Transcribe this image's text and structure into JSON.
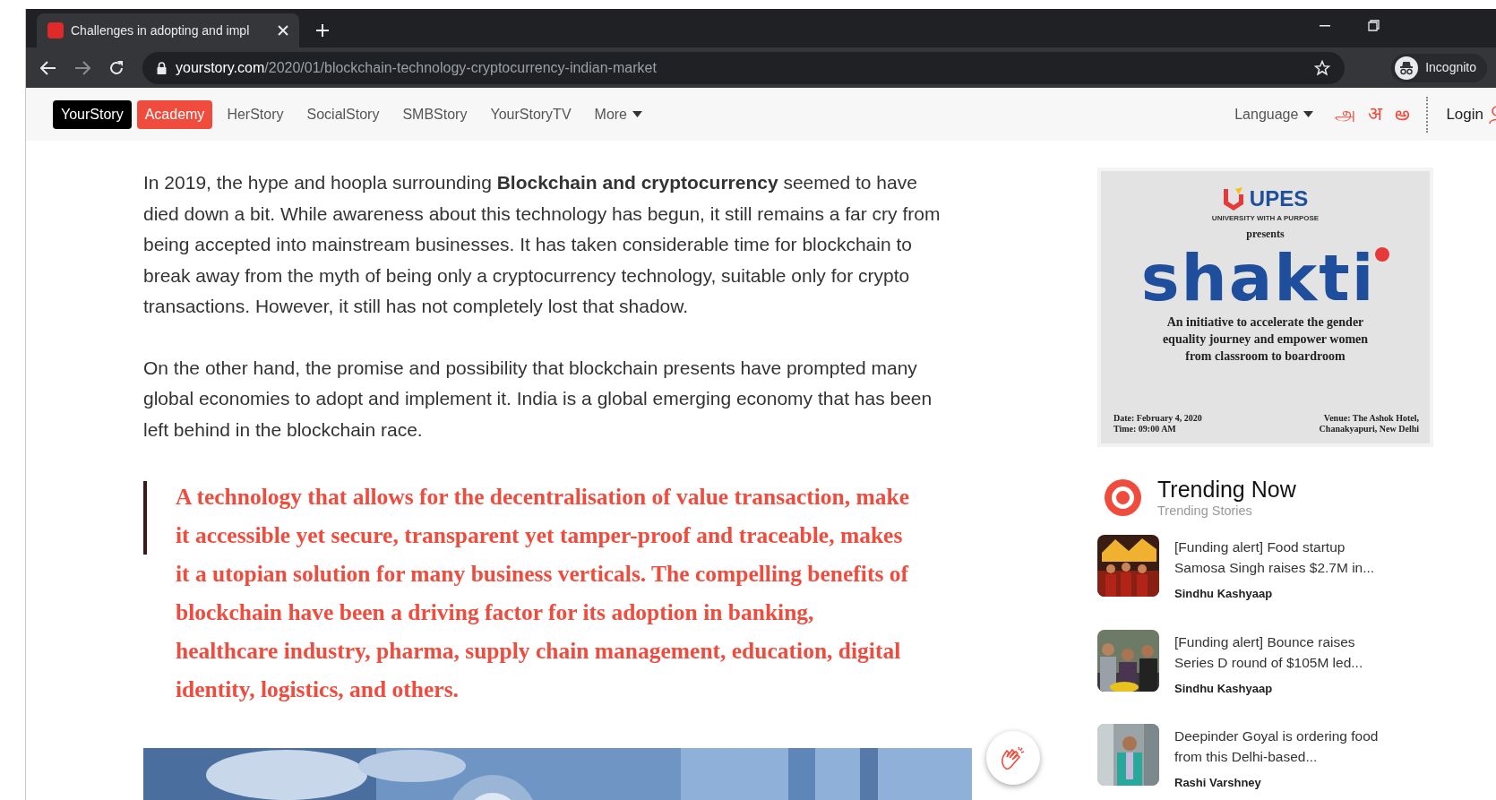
{
  "browser": {
    "tab_title": "Challenges in adopting and impl",
    "url_host": "yourstory.com",
    "url_path": "/2020/01/blockchain-technology-cryptocurrency-indian-market",
    "profile": "Incognito"
  },
  "nav": {
    "items": [
      {
        "label": "YourStory",
        "kind": "brand"
      },
      {
        "label": "Academy",
        "kind": "highlight"
      },
      {
        "label": "HerStory",
        "kind": "link"
      },
      {
        "label": "SocialStory",
        "kind": "link"
      },
      {
        "label": "SMBStory",
        "kind": "link"
      },
      {
        "label": "YourStoryTV",
        "kind": "link"
      },
      {
        "label": "More",
        "kind": "dropdown"
      }
    ],
    "language": "Language",
    "scripts": [
      "அ",
      "अ",
      "అ"
    ],
    "login": "Login"
  },
  "article": {
    "paragraphs": [
      "In 2019, the hype and hoopla surrounding **Blockchain and cryptocurrency** seemed to have died down a bit. While awareness about this technology has begun, it still remains a far cry from being accepted into mainstream businesses. It has taken considerable time for blockchain to break away from the myth of being only a cryptocurrency technology, suitable only for crypto transactions. However, it still has not completely lost that shadow.",
      "On the other hand, the promise and possibility that blockchain presents have prompted many global economies to adopt and implement it. India is a global emerging economy that has been left behind in the blockchain race."
    ],
    "quote": "A technology that allows for the decentralisation of value transaction, make it accessible yet secure, transparent yet tamper-proof and traceable, makes it a utopian solution for many business verticals. The compelling benefits of blockchain have been a driving factor for its adoption in banking, healthcare industry, pharma, supply chain management, education, digital identity, logistics, and others."
  },
  "ad": {
    "brand": "UPES",
    "tagline": "UNIVERSITY WITH A PURPOSE",
    "presents": "presents",
    "title": "shakti",
    "description": "An initiative to accelerate the gender equality journey and empower women from classroom to boardroom",
    "date": "Date: February 4, 2020",
    "time": "Time: 09:00 AM",
    "venue": "Venue: The Ashok Hotel,",
    "venue_area": "Chanakyapuri, New Delhi"
  },
  "trending": {
    "title": "Trending Now",
    "subtitle": "Trending Stories",
    "stories": [
      {
        "title": "[Funding alert] Food startup Samosa Singh raises $2.7M in...",
        "author": "Sindhu Kashyaap"
      },
      {
        "title": "[Funding alert] Bounce raises Series D round of $105M led...",
        "author": "Sindhu Kashyaap"
      },
      {
        "title": "Deepinder Goyal is ordering food from this Delhi-based...",
        "author": "Rashi Varshney"
      }
    ]
  }
}
